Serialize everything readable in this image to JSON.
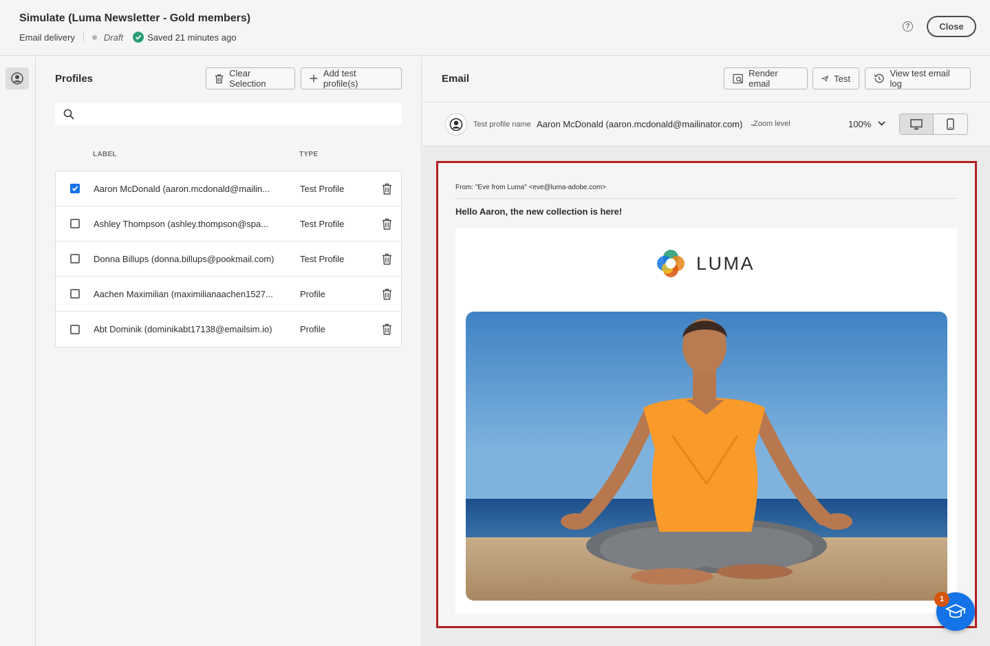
{
  "header": {
    "title": "Simulate (Luma Newsletter - Gold members)",
    "channel": "Email delivery",
    "status": "Draft",
    "saved": "Saved 21 minutes ago",
    "close_label": "Close"
  },
  "profiles": {
    "title": "Profiles",
    "clear_label": "Clear Selection",
    "add_label": "Add test profile(s)",
    "search_placeholder": "",
    "columns": {
      "label": "LABEL",
      "type": "TYPE"
    },
    "rows": [
      {
        "label": "Aaron McDonald (aaron.mcdonald@mailin...",
        "type": "Test Profile",
        "checked": true
      },
      {
        "label": "Ashley Thompson (ashley.thompson@spa...",
        "type": "Test Profile",
        "checked": false
      },
      {
        "label": "Donna Billups (donna.billups@pookmail.com)",
        "type": "Test Profile",
        "checked": false
      },
      {
        "label": "Aachen Maximilian (maximilianaachen1527...",
        "type": "Profile",
        "checked": false
      },
      {
        "label": "Abt Dominik (dominikabt17138@emailsim.io)",
        "type": "Profile",
        "checked": false
      }
    ]
  },
  "email": {
    "title": "Email",
    "render_label": "Render email",
    "test_label": "Test",
    "log_label": "View test email log",
    "profile_name_label": "Test profile name",
    "profile_name": "Aaron McDonald (aaron.mcdonald@mailinator.com)",
    "zoom_label": "Zoom level",
    "zoom_value": "100%",
    "from": "From: \"Eve from Luma\" <eve@luma-adobe.com>",
    "subject": "Hello Aaron, the new collection is here!",
    "logo_text": "LUMA"
  },
  "badge_count": "1",
  "colors": {
    "accent": "#1473e6",
    "preview_border": "#b02020",
    "success": "#2d9d78",
    "badge": "#d7550b"
  }
}
